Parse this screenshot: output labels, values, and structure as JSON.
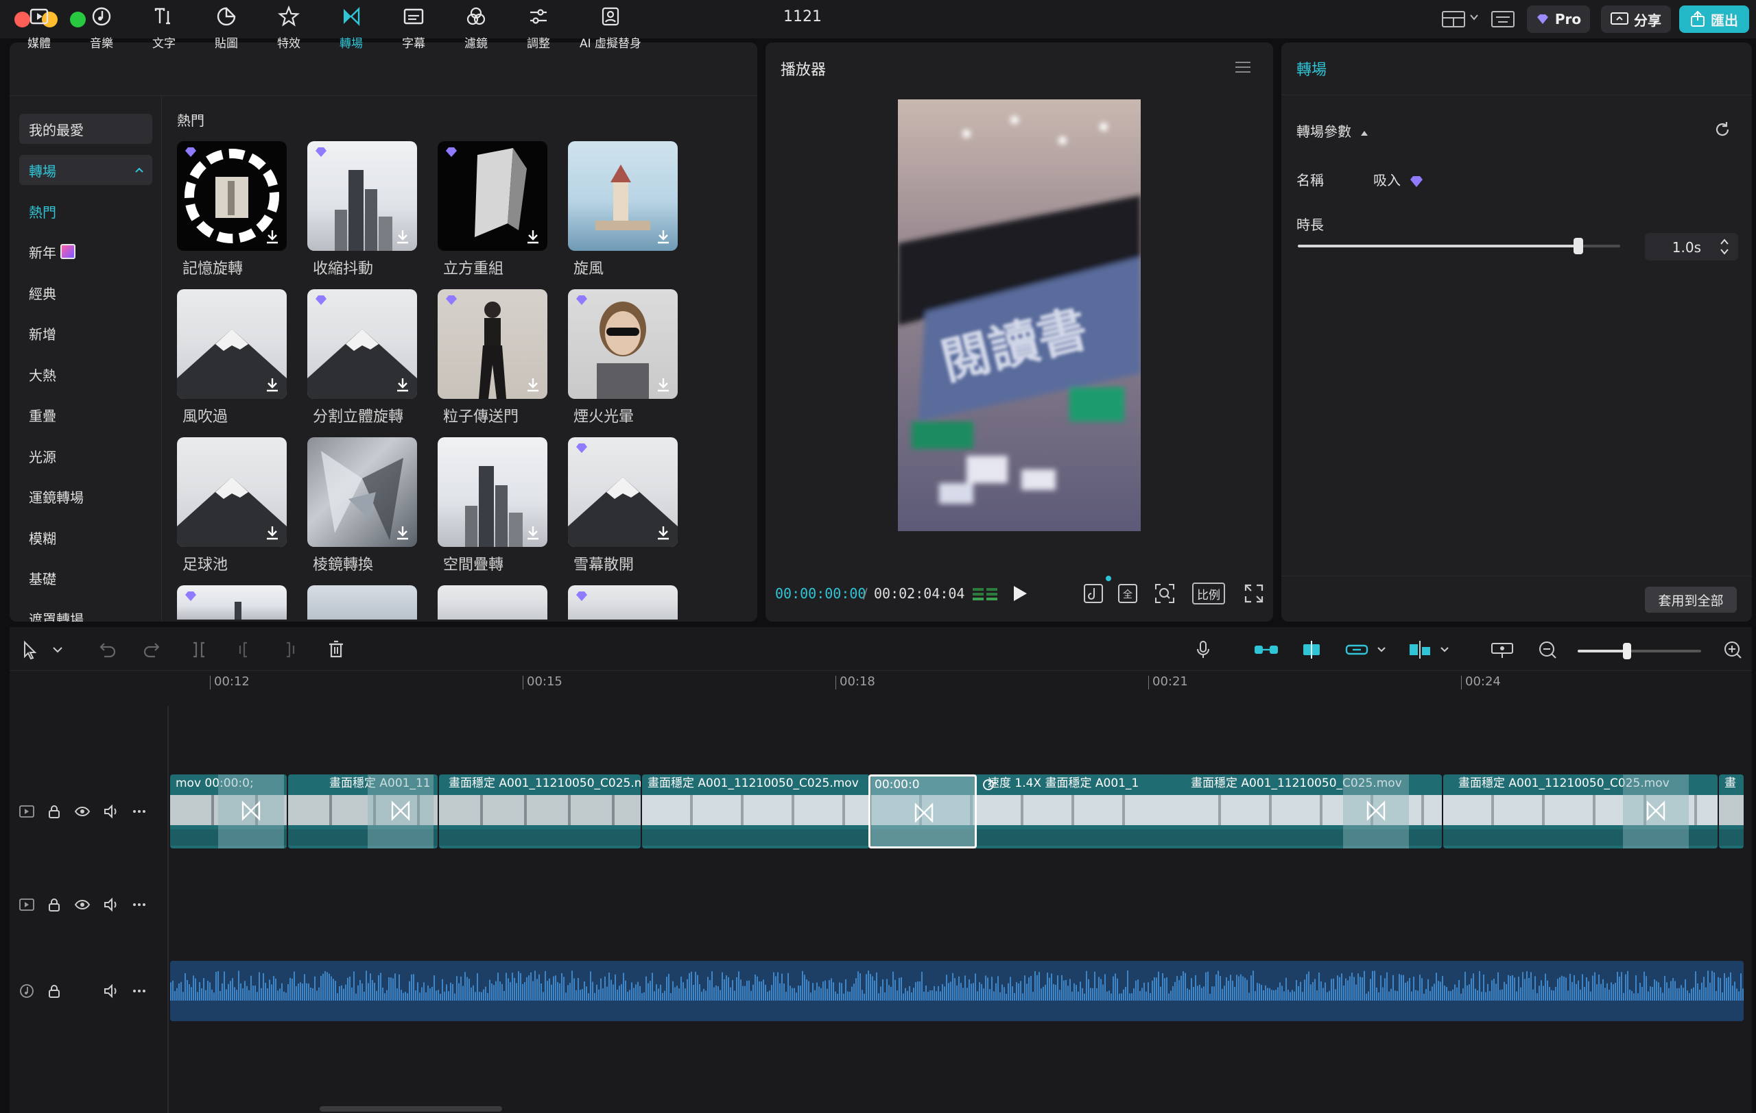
{
  "window": {
    "title": "1121"
  },
  "header": {
    "pro_label": "Pro",
    "share_label": "分享",
    "export_label": "匯出"
  },
  "tooltabs": [
    "媒體",
    "音樂",
    "文字",
    "貼圖",
    "特效",
    "轉場",
    "字幕",
    "濾鏡",
    "調整",
    "AI 虛擬替身"
  ],
  "active_tab": "轉場",
  "categories": [
    "我的最愛",
    "轉場",
    "熱門",
    "新年",
    "經典",
    "新增",
    "大熱",
    "重疊",
    "光源",
    "運鏡轉場",
    "模糊",
    "基礎",
    "遮罩轉場"
  ],
  "section_title": "熱門",
  "transitions": [
    "記憶旋轉",
    "收縮抖動",
    "立方重組",
    "旋風",
    "風吹過",
    "分割立體旋轉",
    "粒子傳送門",
    "煙火光暈",
    "足球池",
    "棱鏡轉換",
    "空間疊轉",
    "雪幕散開"
  ],
  "player": {
    "title": "播放器",
    "current_time": "00:00:00:00",
    "separator": "/",
    "total_time": "00:02:04:04",
    "ratio_label": "比例",
    "video_text": "閱讀書"
  },
  "properties": {
    "title": "轉場",
    "params_label": "轉場參數",
    "name_label": "名稱",
    "name_value": "吸入",
    "duration_label": "時長",
    "duration_value": "1.0s",
    "duration_fraction": 0.87,
    "apply_all_label": "套用到全部"
  },
  "timeline": {
    "ruler": [
      "00:12",
      "00:15",
      "00:18",
      "00:21",
      "00:24"
    ],
    "clips": [
      {
        "label": "mov  00:00:0;"
      },
      {
        "label": "畫面穩定  A001_11"
      },
      {
        "label": "畫面穩定  A001_11210050_C025.m"
      },
      {
        "label": "畫面穩定  A001_11210050_C025.mov"
      },
      {
        "label": "00:00:0"
      },
      {
        "label": "速度 1.4X  畫面穩定  A001_1"
      },
      {
        "label": "畫面穩定  A001_11210050_C025.mov"
      },
      {
        "label": "畫面穩定  A001_11210050_C025.mov"
      },
      {
        "label": "畫"
      }
    ],
    "zoom_fraction": 0.4
  },
  "colors": {
    "accent": "#30c5d6",
    "clip": "#1f6c73",
    "audio": "#1d3f66",
    "export": "#22b8c7"
  }
}
